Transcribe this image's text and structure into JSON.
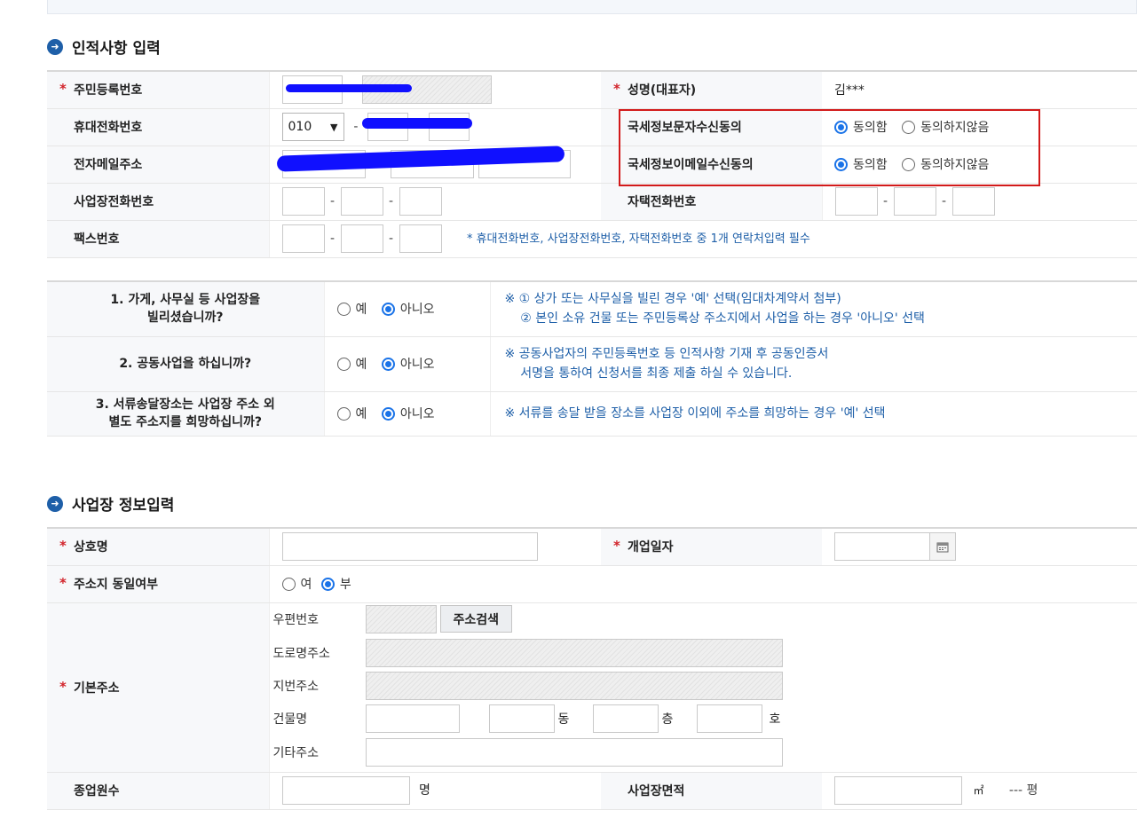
{
  "personal": {
    "title": "인적사항 입력",
    "rrn_label": "주민등록번호",
    "name_label": "성명(대표자)",
    "name_value": "김***",
    "mobile_label": "휴대전화번호",
    "mobile_prefix": "010",
    "sms_consent_label": "국세정보문자수신동의",
    "email_label": "전자메일주소",
    "email_consent_label": "국세정보이메일수신동의",
    "agree_label": "동의함",
    "disagree_label": "동의하지않음",
    "biz_phone_label": "사업장전화번호",
    "home_phone_label": "자택전화번호",
    "fax_label": "팩스번호",
    "notice": "* 휴대전화번호, 사업장전화번호, 자택전화번호 중 1개 연락처입력 필수"
  },
  "questions": [
    {
      "q": "1. 가게, 사무실 등 사업장을\n빌리셨습니까?",
      "yes": "예",
      "no": "아니오",
      "note": "※ ① 상가 또는 사무실을 빌린 경우 '예' 선택(임대차계약서 첨부)\n    ② 본인 소유 건물 또는 주민등록상 주소지에서 사업을 하는 경우 '아니오' 선택"
    },
    {
      "q": "2. 공동사업을 하십니까?",
      "yes": "예",
      "no": "아니오",
      "note": "※ 공동사업자의 주민등록번호 등 인적사항 기재 후 공동인증서\n    서명을 통하여 신청서를 최종 제출 하실 수 있습니다."
    },
    {
      "q": "3. 서류송달장소는 사업장 주소 외\n별도 주소지를 희망하십니까?",
      "yes": "예",
      "no": "아니오",
      "note": "※ 서류를 송달 받을 장소를 사업장 이외에 주소를 희망하는 경우 '예' 선택"
    }
  ],
  "business": {
    "title": "사업장 정보입력",
    "trade_name_label": "상호명",
    "open_date_label": "개업일자",
    "same_address_label": "주소지 동일여부",
    "same_yes": "여",
    "same_no": "부",
    "base_address_label": "기본주소",
    "postal_label": "우편번호",
    "search_button": "주소검색",
    "road_label": "도로명주소",
    "lot_label": "지번주소",
    "building_label": "건물명",
    "dong_unit": "동",
    "floor_unit": "층",
    "ho_unit": "호",
    "other_label": "기타주소",
    "employees_label": "종업원수",
    "employees_unit": "명",
    "area_label": "사업장면적",
    "area_unit": "㎡",
    "pyeong_text": "--- 평"
  }
}
